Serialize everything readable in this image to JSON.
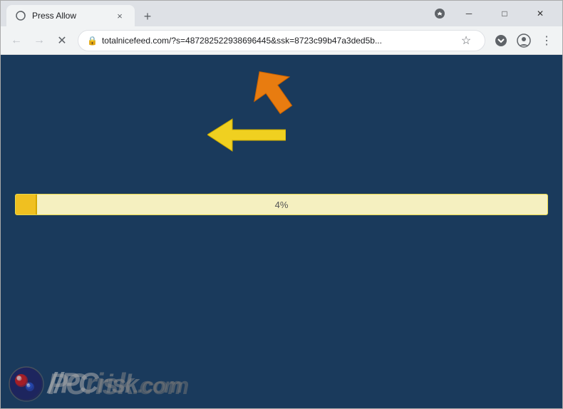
{
  "browser": {
    "tab": {
      "title": "Press Allow",
      "favicon": "⟳"
    },
    "new_tab_label": "+",
    "window_controls": {
      "minimize": "─",
      "maximize": "□",
      "close": "✕"
    },
    "nav": {
      "back": "←",
      "forward": "→",
      "close_loading": "✕"
    },
    "address_bar": {
      "url": "totalnicefeed.com/?s=487282522938696445&ssk=8723c99b47a3ded5b...",
      "lock_icon": "🔒",
      "star_icon": "☆",
      "profile_icon": "👤",
      "ext_icon": "⬇",
      "menu_icon": "⋮"
    }
  },
  "page": {
    "background_color": "#1b3d5f",
    "progress": {
      "value": 4,
      "label": "4%",
      "fill_color": "#f0c020",
      "bg_color": "#f5f0c0"
    },
    "arrows": {
      "orange_color": "#e87c10",
      "yellow_color": "#f0d020"
    }
  },
  "watermark": {
    "text_pc": "PC",
    "text_risk": "risk",
    "text_dotcom": ".com"
  }
}
